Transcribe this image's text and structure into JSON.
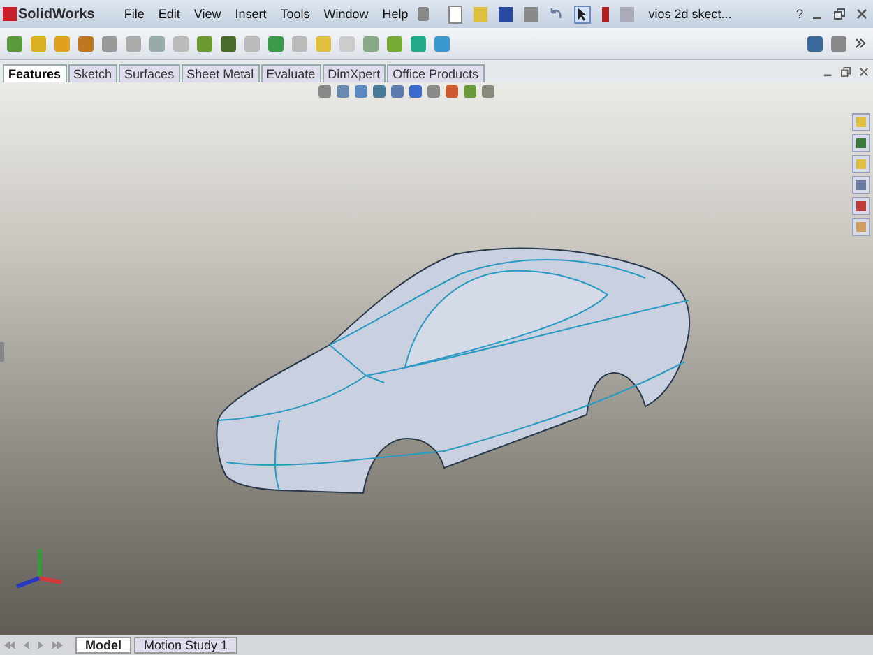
{
  "app": {
    "name": "SolidWorks"
  },
  "menu": [
    "File",
    "Edit",
    "View",
    "Insert",
    "Tools",
    "Window",
    "Help"
  ],
  "document_title": "vios 2d skect...",
  "help_label": "?",
  "tabs": [
    {
      "label": "Features",
      "selected": true
    },
    {
      "label": "Sketch",
      "selected": false
    },
    {
      "label": "Surfaces",
      "selected": false
    },
    {
      "label": "Sheet Metal",
      "selected": false
    },
    {
      "label": "Evaluate",
      "selected": false
    },
    {
      "label": "DimXpert",
      "selected": false
    },
    {
      "label": "Office Products",
      "selected": false
    }
  ],
  "bottom_tabs": [
    {
      "label": "Model",
      "selected": true
    },
    {
      "label": "Motion Study 1",
      "selected": false
    }
  ]
}
